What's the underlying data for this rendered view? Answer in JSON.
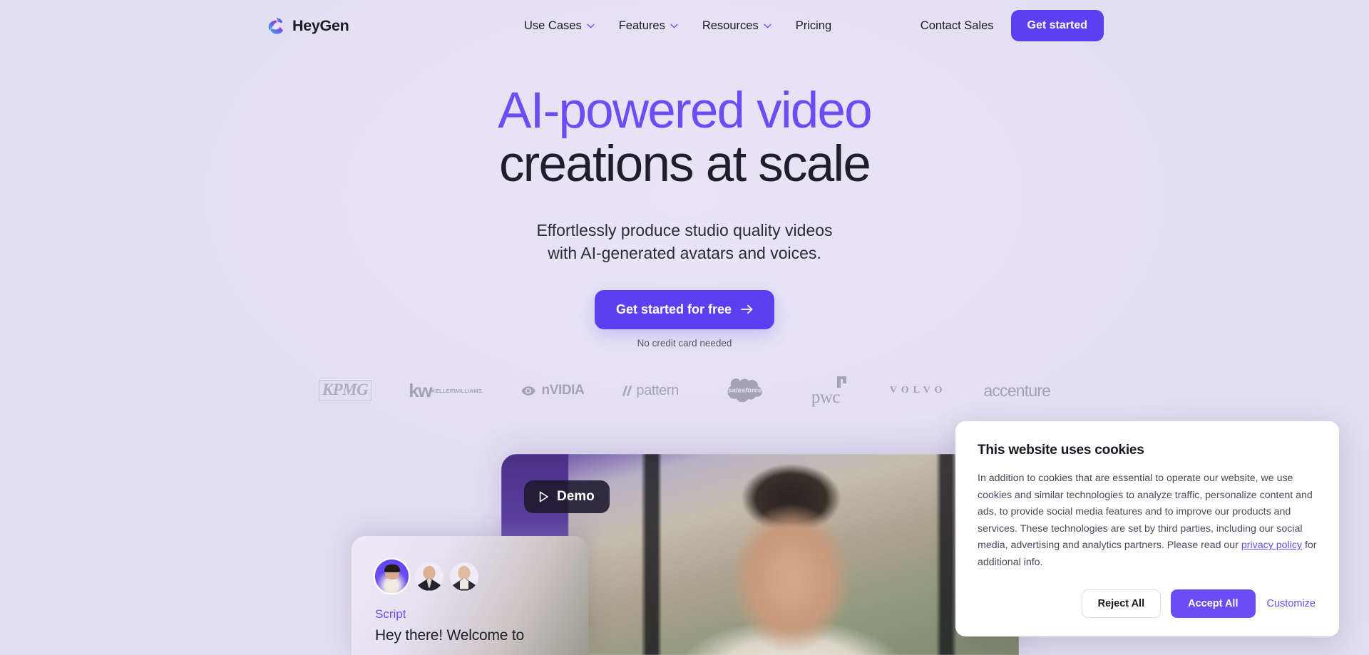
{
  "brand": {
    "name": "HeyGen",
    "logo_icon": "heygen-play-swirl-icon",
    "gradient_from": "#2bb7f0",
    "gradient_to": "#a832d6"
  },
  "nav": {
    "items": [
      {
        "label": "Use Cases",
        "has_dropdown": true
      },
      {
        "label": "Features",
        "has_dropdown": true
      },
      {
        "label": "Resources",
        "has_dropdown": true
      },
      {
        "label": "Pricing",
        "has_dropdown": false
      }
    ],
    "contact_sales": "Contact Sales",
    "get_started": "Get started"
  },
  "hero": {
    "headline_accent": "AI-powered video",
    "headline_plain": "creations at scale",
    "subtitle_line1": "Effortlessly produce studio quality videos",
    "subtitle_line2": "with AI-generated avatars and voices.",
    "cta_label": "Get started for free",
    "cta_icon": "arrow-right-icon",
    "cta_note": "No credit card needed"
  },
  "logos": [
    {
      "name": "KPMG",
      "text": "KPMG"
    },
    {
      "name": "Keller Williams",
      "text_primary": "kw",
      "text_secondary": "KELLERWILLIAMS."
    },
    {
      "name": "NVIDIA",
      "text": "nVIDIA"
    },
    {
      "name": "Pattern",
      "text": "pattern"
    },
    {
      "name": "Salesforce",
      "text": "salesforce"
    },
    {
      "name": "pwc",
      "text": "pwc"
    },
    {
      "name": "Volvo",
      "text": "VOLVO"
    },
    {
      "name": "Accenture",
      "text": "accenture"
    }
  ],
  "video": {
    "demo_label": "Demo",
    "play_icon": "play-triangle-icon"
  },
  "script_card": {
    "label": "Script",
    "text": "Hey there! Welcome to",
    "avatar_count": 3
  },
  "cookie_banner": {
    "title": "This website uses cookies",
    "body_part1": "In addition to cookies that are essential to operate our website, we use cookies and similar technologies to analyze traffic, personalize content and ads, to provide social media features and to improve our products and services. These technologies are set by third parties, including our social media, advertising and analytics partners. Please read our ",
    "privacy_link": "privacy policy",
    "body_part2": " for additional info.",
    "reject_label": "Reject All",
    "accept_label": "Accept All",
    "customize_label": "Customize"
  },
  "colors": {
    "page_bg": "#e4e0f2",
    "accent_purple": "#6b4df5",
    "button_purple": "#5b3ff0",
    "text_dark": "#1b1b23"
  }
}
